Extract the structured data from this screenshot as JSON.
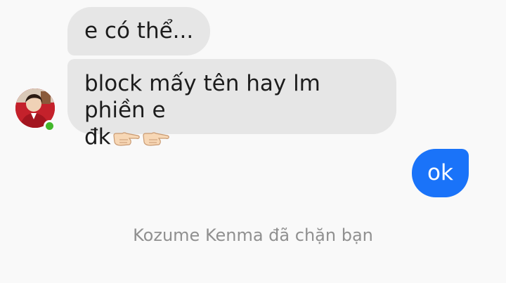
{
  "messages": [
    {
      "direction": "incoming",
      "text": "e có thể..."
    },
    {
      "direction": "incoming",
      "text_line1": "block mấy tên hay lm phiền e",
      "text_line2": "đk",
      "emoji": "pointing-right-hand-icon x2"
    },
    {
      "direction": "outgoing",
      "text": "ok"
    }
  ],
  "contact": {
    "avatar": "avatar-portrait",
    "online": true,
    "online_color": "#42b72a"
  },
  "status_text": "Kozume Kenma đã chặn bạn",
  "colors": {
    "background": "#f9f9f9",
    "incoming_bubble": "#e6e6e6",
    "outgoing_bubble": "#1a73f9",
    "status_text": "#909090"
  }
}
